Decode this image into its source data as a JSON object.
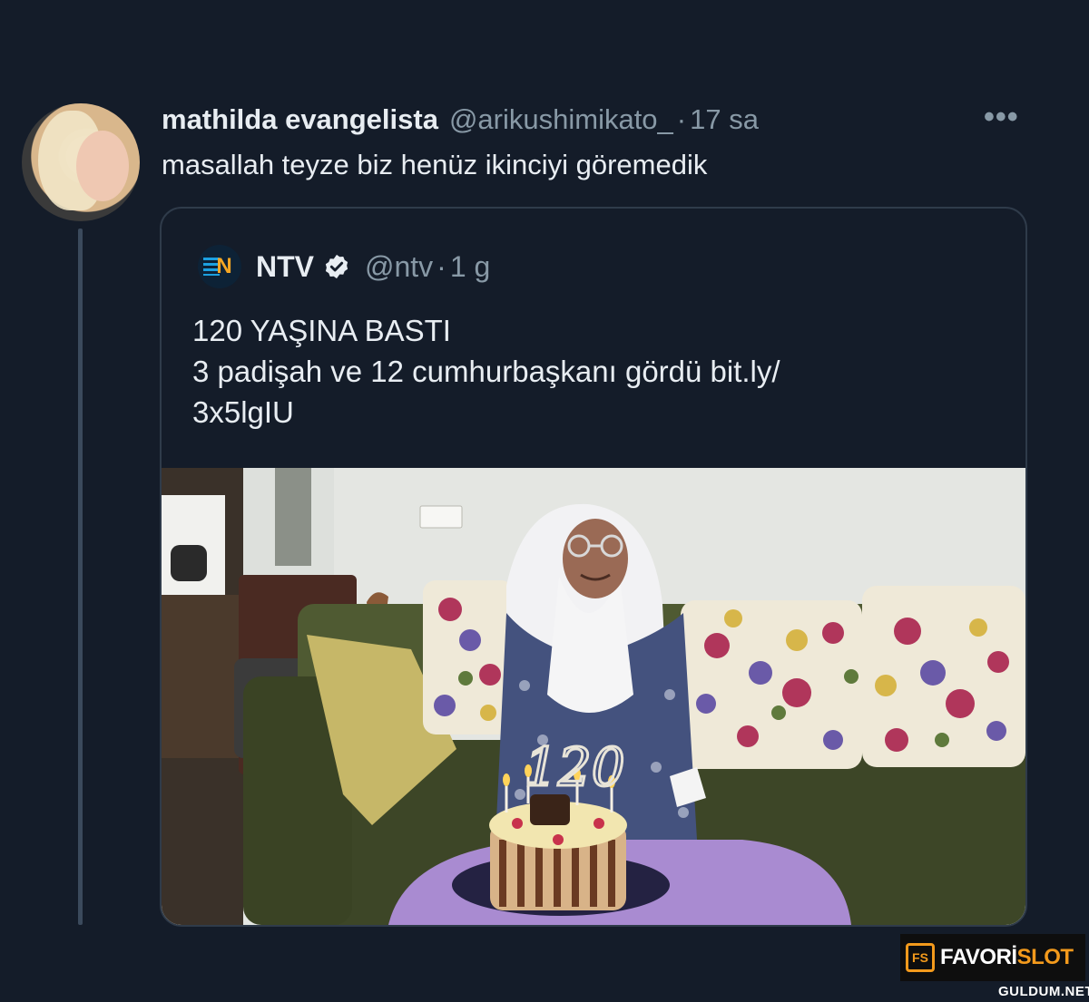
{
  "tweet": {
    "display_name": "mathilda evangelista",
    "handle": "@arikushimikato_",
    "separator": "·",
    "time": "17 sa",
    "more_label": "•••",
    "text": "masallah teyze biz henüz ikinciyi göremedik"
  },
  "quote": {
    "logo_letter": "N",
    "display_name": "NTV",
    "handle": "@ntv",
    "separator": "·",
    "time": "1 g",
    "text_lines": [
      "120 YAŞINA BASTI",
      "3 padişah ve 12 cumhurbaşkanı gördü bit.ly/",
      "3x5lgIU"
    ],
    "cake_number": "120"
  },
  "watermark": {
    "icon_text": "FS",
    "brand_main": "FAVORİ",
    "brand_accent": "SLOT",
    "sub": "GULDUM.NET"
  },
  "colors": {
    "background": "#141c29",
    "secondary_text": "#8899a6",
    "verified_badge": "#e8edf2",
    "watermark_accent": "#f39a1c"
  }
}
